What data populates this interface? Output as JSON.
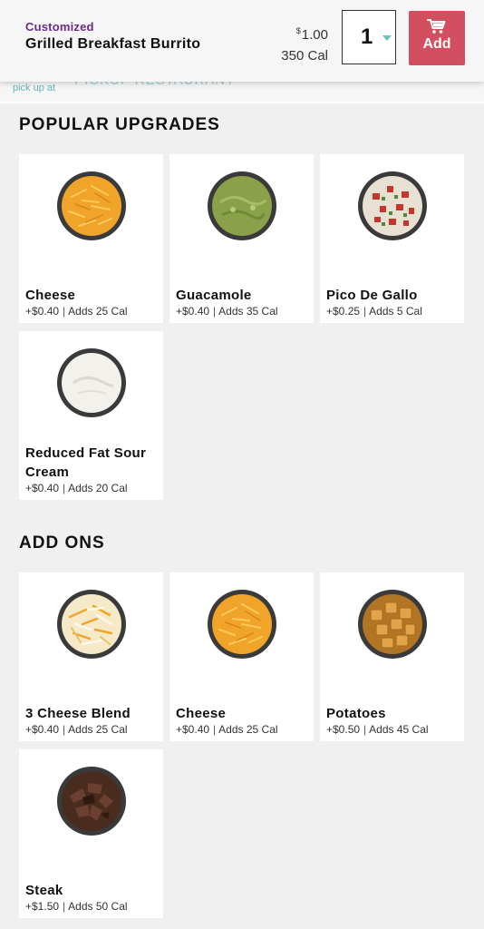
{
  "header": {
    "customized": "Customized",
    "item_name": "Grilled Breakfast Burrito",
    "price_symbol": "$",
    "price_value": "1.00",
    "calories": "350 Cal",
    "quantity": "1",
    "add_label": "Add"
  },
  "pickup": {
    "label": "pick up at",
    "restaurant": "PICKUP RESTAURANT"
  },
  "sections": {
    "popular": {
      "title": "POPULAR UPGRADES",
      "items": [
        {
          "name": "Cheese",
          "price": "+$0.40",
          "cal": "Adds 25 Cal",
          "icon": "shredded-cheese-icon"
        },
        {
          "name": "Guacamole",
          "price": "+$0.40",
          "cal": "Adds 35 Cal",
          "icon": "guacamole-icon"
        },
        {
          "name": "Pico De Gallo",
          "price": "+$0.25",
          "cal": "Adds 5 Cal",
          "icon": "pico-de-gallo-icon"
        },
        {
          "name": "Reduced Fat Sour Cream",
          "price": "+$0.40",
          "cal": "Adds 20 Cal",
          "icon": "sour-cream-icon"
        }
      ]
    },
    "addons": {
      "title": "ADD ONS",
      "items": [
        {
          "name": "3 Cheese Blend",
          "price": "+$0.40",
          "cal": "Adds 25 Cal",
          "icon": "three-cheese-blend-icon"
        },
        {
          "name": "Cheese",
          "price": "+$0.40",
          "cal": "Adds 25 Cal",
          "icon": "shredded-cheese-icon"
        },
        {
          "name": "Potatoes",
          "price": "+$0.50",
          "cal": "Adds 45 Cal",
          "icon": "potatoes-icon"
        },
        {
          "name": "Steak",
          "price": "+$1.50",
          "cal": "Adds 50 Cal",
          "icon": "steak-icon"
        }
      ]
    }
  },
  "colors": {
    "accent_purple": "#6b2a83",
    "add_button": "#d14f5f",
    "teal": "#63b8b8",
    "background": "#f0f0f0"
  }
}
